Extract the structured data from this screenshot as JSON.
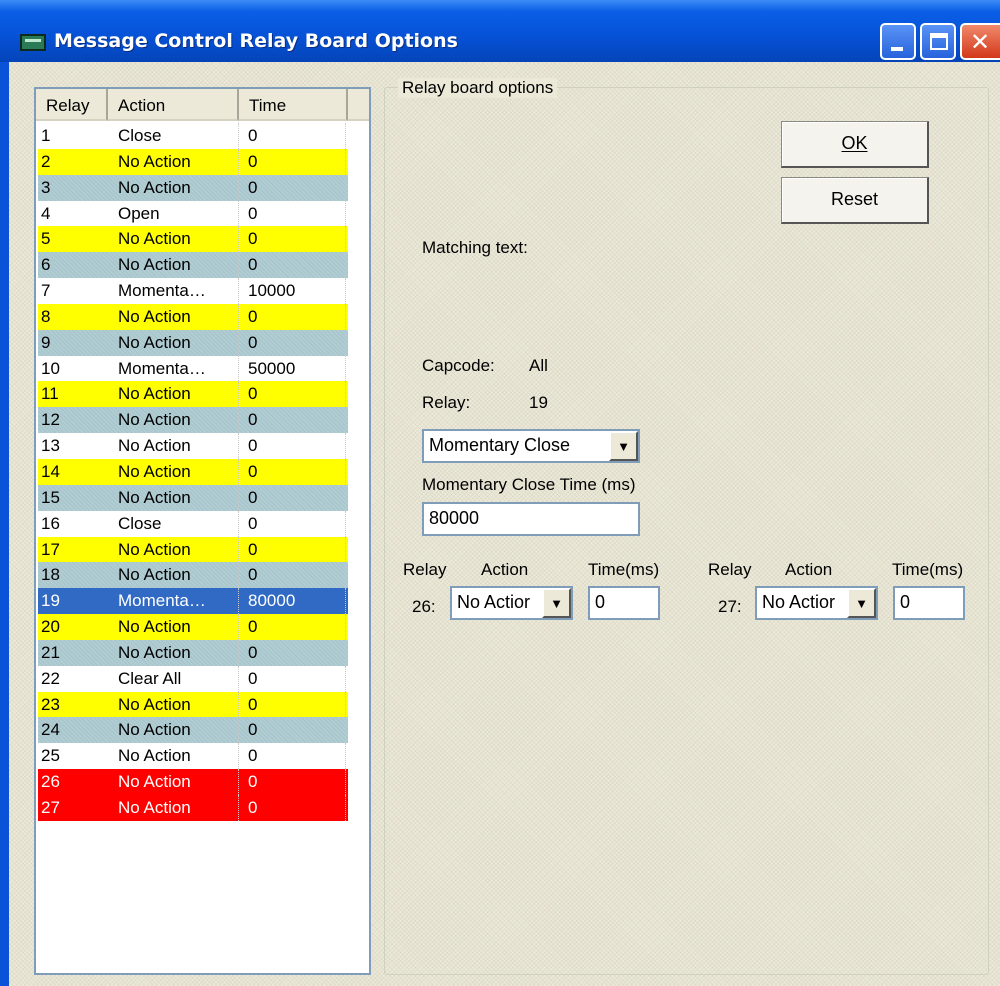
{
  "window": {
    "title": "Message Control Relay Board Options",
    "controls": {
      "minimize": "minimize-icon",
      "maximize": "maximize-icon",
      "close": "close-icon"
    }
  },
  "list": {
    "columns": [
      "Relay",
      "Action",
      "Time"
    ],
    "rows": [
      {
        "relay": "1",
        "action": "Close",
        "time": "0",
        "color": "white"
      },
      {
        "relay": "2",
        "action": "No Action",
        "time": "0",
        "color": "yellow"
      },
      {
        "relay": "3",
        "action": "No Action",
        "time": "0",
        "color": "teal"
      },
      {
        "relay": "4",
        "action": "Open",
        "time": "0",
        "color": "white"
      },
      {
        "relay": "5",
        "action": "No Action",
        "time": "0",
        "color": "yellow"
      },
      {
        "relay": "6",
        "action": "No Action",
        "time": "0",
        "color": "teal"
      },
      {
        "relay": "7",
        "action": "Momenta…",
        "time": "10000",
        "color": "white"
      },
      {
        "relay": "8",
        "action": "No Action",
        "time": "0",
        "color": "yellow"
      },
      {
        "relay": "9",
        "action": "No Action",
        "time": "0",
        "color": "teal"
      },
      {
        "relay": "10",
        "action": "Momenta…",
        "time": "50000",
        "color": "white"
      },
      {
        "relay": "11",
        "action": "No Action",
        "time": "0",
        "color": "yellow"
      },
      {
        "relay": "12",
        "action": "No Action",
        "time": "0",
        "color": "teal"
      },
      {
        "relay": "13",
        "action": "No Action",
        "time": "0",
        "color": "white"
      },
      {
        "relay": "14",
        "action": "No Action",
        "time": "0",
        "color": "yellow"
      },
      {
        "relay": "15",
        "action": "No Action",
        "time": "0",
        "color": "teal"
      },
      {
        "relay": "16",
        "action": "Close",
        "time": "0",
        "color": "white"
      },
      {
        "relay": "17",
        "action": "No Action",
        "time": "0",
        "color": "yellow"
      },
      {
        "relay": "18",
        "action": "No Action",
        "time": "0",
        "color": "teal"
      },
      {
        "relay": "19",
        "action": "Momenta…",
        "time": "80000",
        "color": "selected"
      },
      {
        "relay": "20",
        "action": "No Action",
        "time": "0",
        "color": "yellow"
      },
      {
        "relay": "21",
        "action": "No Action",
        "time": "0",
        "color": "teal"
      },
      {
        "relay": "22",
        "action": "Clear All",
        "time": "0",
        "color": "white"
      },
      {
        "relay": "23",
        "action": "No Action",
        "time": "0",
        "color": "yellow"
      },
      {
        "relay": "24",
        "action": "No Action",
        "time": "0",
        "color": "teal"
      },
      {
        "relay": "25",
        "action": "No Action",
        "time": "0",
        "color": "white"
      },
      {
        "relay": "26",
        "action": "No Action",
        "time": "0",
        "color": "red"
      },
      {
        "relay": "27",
        "action": "No Action",
        "time": "0",
        "color": "red"
      }
    ]
  },
  "options": {
    "group_label": "Relay board options",
    "ok_label": "OK",
    "reset_label": "Reset",
    "matching_text_label": "Matching text:",
    "capcode_label": "Capcode:",
    "capcode_value": "All",
    "relay_label": "Relay:",
    "relay_value": "19",
    "action_select": "Momentary Close",
    "momentary_time_label": "Momentary Close Time (ms)",
    "momentary_time_value": "80000",
    "sub_relays": [
      {
        "header_relay": "Relay",
        "header_action": "Action",
        "header_time": "Time(ms)",
        "number": "26:",
        "action": "No Actior",
        "time": "0"
      },
      {
        "header_relay": "Relay",
        "header_action": "Action",
        "header_time": "Time(ms)",
        "number": "27:",
        "action": "No Actior",
        "time": "0"
      }
    ]
  },
  "colors": {
    "title_bar": "#0651d6",
    "row_yellow": "#ffff00",
    "row_teal": "#b0cdd4",
    "row_red": "#ff0000",
    "row_selected": "#316ac5"
  }
}
